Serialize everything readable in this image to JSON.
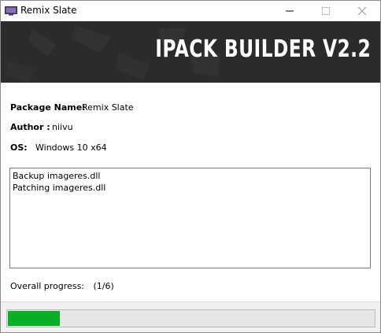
{
  "window": {
    "title": "Remix Slate",
    "minimize_icon": "minimize-icon",
    "maximize_icon": "maximize-icon",
    "close_icon": "close-icon",
    "app_icon": "monitor-icon"
  },
  "banner": {
    "title": "IPACK BUILDER V2.2"
  },
  "info": {
    "package_label": "Package Name:",
    "package_value": "Remix Slate",
    "author_label": "Author :",
    "author_value": "niivu",
    "os_label": "OS:",
    "os_value": "Windows 10 x64"
  },
  "log": {
    "lines": [
      "Backup imageres.dll",
      "Patching imageres.dll"
    ]
  },
  "progress": {
    "caption": "Overall progress:",
    "count": "(1/6)",
    "fraction": 0.1429,
    "color": "#06b025"
  }
}
